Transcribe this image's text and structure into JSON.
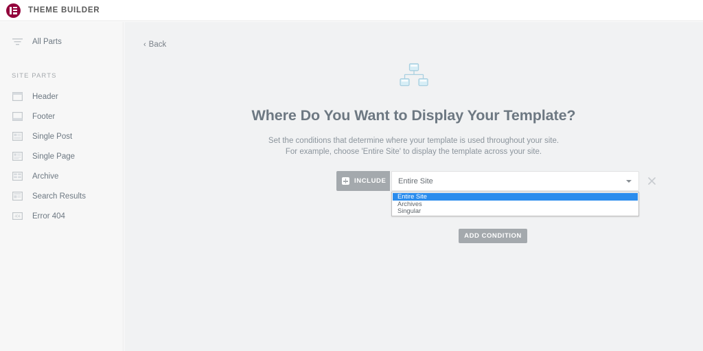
{
  "topbar": {
    "title": "THEME BUILDER",
    "logo_icon": "elementor-logo-icon",
    "logo_color": "#92003b"
  },
  "sidebar": {
    "all_parts": {
      "label": "All Parts",
      "icon": "filter-icon"
    },
    "section_title": "SITE PARTS",
    "items": [
      {
        "label": "Header",
        "icon": "header-layout-icon"
      },
      {
        "label": "Footer",
        "icon": "footer-layout-icon"
      },
      {
        "label": "Single Post",
        "icon": "single-post-icon"
      },
      {
        "label": "Single Page",
        "icon": "single-page-icon"
      },
      {
        "label": "Archive",
        "icon": "archive-grid-icon"
      },
      {
        "label": "Search Results",
        "icon": "search-results-icon"
      },
      {
        "label": "Error 404",
        "icon": "error-404-icon"
      }
    ]
  },
  "main": {
    "back_label": "Back",
    "back_icon": "chevron-left-icon",
    "hero_icon": "sitemap-icon",
    "hero_icon_color": "#a8d8e8",
    "title": "Where Do You Want to Display Your Template?",
    "description_line1": "Set the conditions that determine where your template is used throughout your site.",
    "description_line2": "For example, choose 'Entire Site' to display the template across your site."
  },
  "condition": {
    "include_label": "INCLUDE",
    "include_icon": "plus-icon",
    "include_caret_icon": "caret-down-icon",
    "include_bg": "#a4a9ad",
    "select_value": "Entire Site",
    "select_caret_icon": "caret-down-icon",
    "dropdown_open": true,
    "options": [
      {
        "label": "Entire Site",
        "selected": true
      },
      {
        "label": "Archives",
        "selected": false
      },
      {
        "label": "Singular",
        "selected": false
      }
    ],
    "highlight_color": "#2a8ced",
    "remove_icon": "close-x-icon"
  },
  "actions": {
    "add_condition_label": "ADD CONDITION"
  }
}
